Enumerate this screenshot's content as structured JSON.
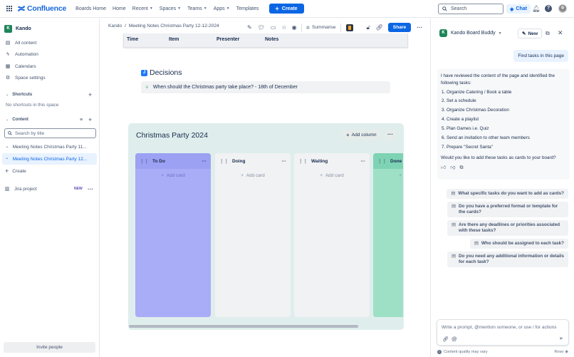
{
  "topbar": {
    "app_name": "Confluence",
    "nav": [
      "Boards Home",
      "Home",
      "Recent",
      "Spaces",
      "Teams",
      "Apps",
      "Templates"
    ],
    "create_label": "Create",
    "search_placeholder": "Search",
    "chat_label": "Chat"
  },
  "sidebar": {
    "space_name": "Kando",
    "items": [
      {
        "icon": "document-stack-icon",
        "label": "All content"
      },
      {
        "icon": "lightning-icon",
        "label": "Automation"
      },
      {
        "icon": "calendar-icon",
        "label": "Calendars"
      },
      {
        "icon": "settings-icon",
        "label": "Space settings"
      }
    ],
    "shortcuts_title": "Shortcuts",
    "shortcuts_empty": "No shortcuts in this space",
    "content_title": "Content",
    "filter_placeholder": "Search by title",
    "pages": [
      "Meeting Notes Christmas Party 11...",
      "Meeting Notes Christmas Party 12..."
    ],
    "create_label": "Create",
    "jira_label": "Jira project",
    "jira_badge": "NEW",
    "invite_label": "Invite people"
  },
  "page": {
    "breadcrumb_space": "Kando",
    "breadcrumb_sep": "/",
    "breadcrumb_page": "Meeting Notes Christmas Party 12-12-2024",
    "summarise_label": "Summarise",
    "share_label": "Share",
    "table_headers": [
      "Time",
      "Item",
      "Presenter",
      "Notes"
    ],
    "decisions_title": "Decisions",
    "decision_text": "When should the Christmas party take place? - 18th of December",
    "board_title": "Christmas Party 2024",
    "add_column_label": "Add column",
    "columns": [
      {
        "name": "To Do",
        "color": "#a4a7f5",
        "body": "#a9acf6"
      },
      {
        "name": "Doing",
        "color": "#eeeeee",
        "body": "#f1f2f4"
      },
      {
        "name": "Waiting",
        "color": "#eeeeee",
        "body": "#f1f2f4"
      },
      {
        "name": "Done",
        "color": "#7ed3b4",
        "body": "#9ee0c6"
      }
    ],
    "add_card_label": "Add card"
  },
  "panel": {
    "title": "Kando Board Buddy",
    "new_label": "New",
    "user_message": "Find tasks in this page",
    "reply_intro": "I have reviewed the content of the page and identified the following tasks:",
    "tasks": [
      "Organize Catering / Book a table",
      "Set a schedule",
      "Organize Christmas Decoration",
      "Create a playlist",
      "Plan Games i.e. Quiz",
      "Send an invitation to other team members",
      "Prepare \"Secret Santa\""
    ],
    "reply_question": "Would you like to add these tasks as cards to your board?",
    "suggestions": [
      "What specific tasks do you want to add as cards?",
      "Do you have a preferred format or template for the cards?",
      "Are there any deadlines or priorities associated with these tasks?",
      "Who should be assigned to each task?",
      "Do you need any additional information or details for each task?"
    ],
    "prompt_placeholder": "Write a prompt, @mention someone, or use / for actions",
    "footer_note": "Content quality may vary",
    "footer_brand": "Rovo"
  },
  "colors": {
    "accent": "#0c66e4",
    "sidebar_selected": "#e9f2ff"
  }
}
